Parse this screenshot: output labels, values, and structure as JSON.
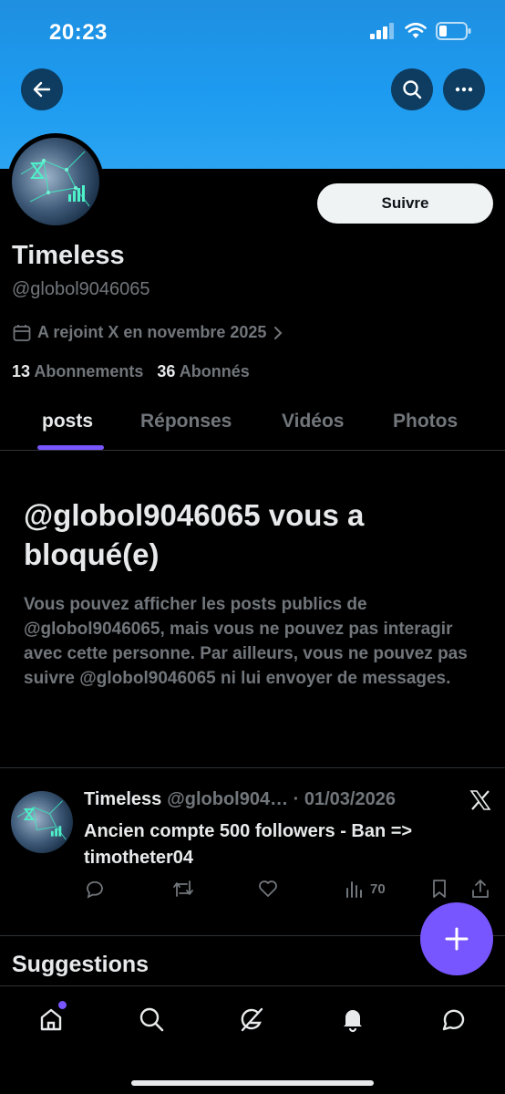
{
  "status_bar": {
    "time": "20:23"
  },
  "profile": {
    "name": "Timeless",
    "handle": "@globol9046065",
    "follow_label": "Suivre",
    "joined": "A rejoint X en novembre 2025",
    "following_count": "13",
    "following_label": "Abonnements",
    "followers_count": "36",
    "followers_label": "Abonnés"
  },
  "tabs": [
    {
      "label": "posts",
      "active": true
    },
    {
      "label": "Réponses"
    },
    {
      "label": "Vidéos"
    },
    {
      "label": "Photos"
    }
  ],
  "blocked": {
    "title": "@globol9046065 vous a bloqué(e)",
    "description": "Vous pouvez afficher les posts publics de @globol9046065, mais vous ne pouvez pas interagir avec cette personne. Par ailleurs, vous ne pouvez pas suivre @globol9046065 ni lui envoyer de messages."
  },
  "post": {
    "author": "Timeless",
    "meta": "@globol904… · 01/03/2026",
    "text": "Ancien compte 500 followers - Ban => timotheter04",
    "views": "70"
  },
  "suggestions_label": "Suggestions",
  "colors": {
    "accent": "#7856ff",
    "banner": "#1d9bf0",
    "muted": "#71767b"
  },
  "icons": [
    "back-arrow-icon",
    "search-icon",
    "more-icon",
    "calendar-icon",
    "chevron-right-icon",
    "x-logo-icon",
    "reply-icon",
    "repost-icon",
    "like-icon",
    "views-icon",
    "bookmark-icon",
    "share-icon",
    "plus-icon",
    "home-icon",
    "explore-icon",
    "grok-icon",
    "notifications-icon",
    "messages-icon"
  ]
}
